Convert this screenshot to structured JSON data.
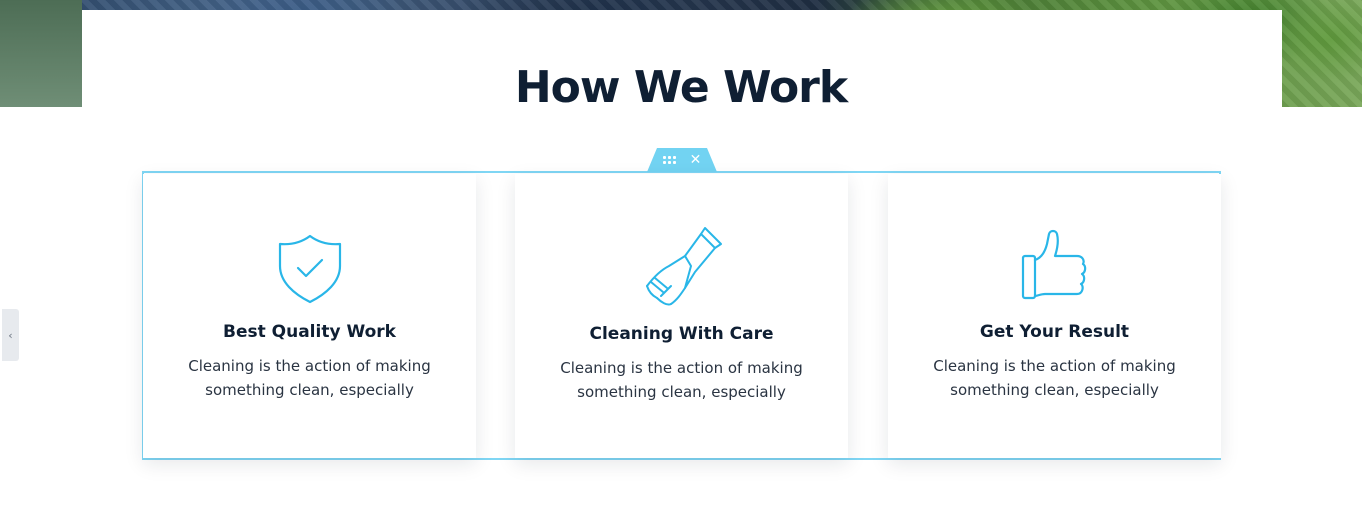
{
  "section": {
    "title": "How We Work"
  },
  "editor": {
    "drag_icon": "drag-handle-icon",
    "close_icon": "close-icon",
    "close_glyph": "✕",
    "accent_color": "#72d3f2"
  },
  "side_panel": {
    "toggle_glyph": "‹"
  },
  "cards": [
    {
      "icon": "shield-check-icon",
      "title": "Best Quality Work",
      "description": "Cleaning is the action of making something clean, especially"
    },
    {
      "icon": "glove-icon",
      "title": "Cleaning With Care",
      "description": "Cleaning is the action of making something clean, especially"
    },
    {
      "icon": "thumbs-up-icon",
      "title": "Get Your Result",
      "description": "Cleaning is the action of making something clean, especially"
    }
  ],
  "colors": {
    "heading": "#0f1f33",
    "icon": "#29b6e8"
  }
}
